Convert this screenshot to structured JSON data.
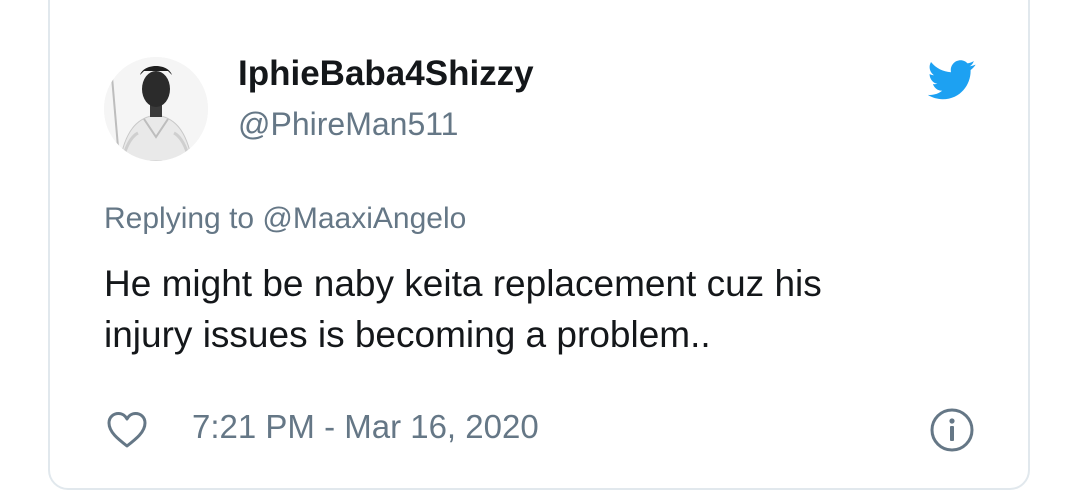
{
  "tweet": {
    "display_name": "IphieBaba4Shizzy",
    "handle": "@PhireMan511",
    "replying_to": "Replying to @MaaxiAngelo",
    "text_lines": [
      "He might be naby keita replacement cuz his",
      "injury issues is becoming a problem.."
    ],
    "timestamp": "7:21 PM - Mar 16, 2020"
  },
  "icons": {
    "brand": "twitter-bird-icon",
    "like": "heart-icon",
    "info": "info-icon"
  },
  "colors": {
    "twitter_blue": "#1da1f2",
    "primary_text": "#14171a",
    "secondary_text": "#657786",
    "border": "#e1e8ed"
  }
}
